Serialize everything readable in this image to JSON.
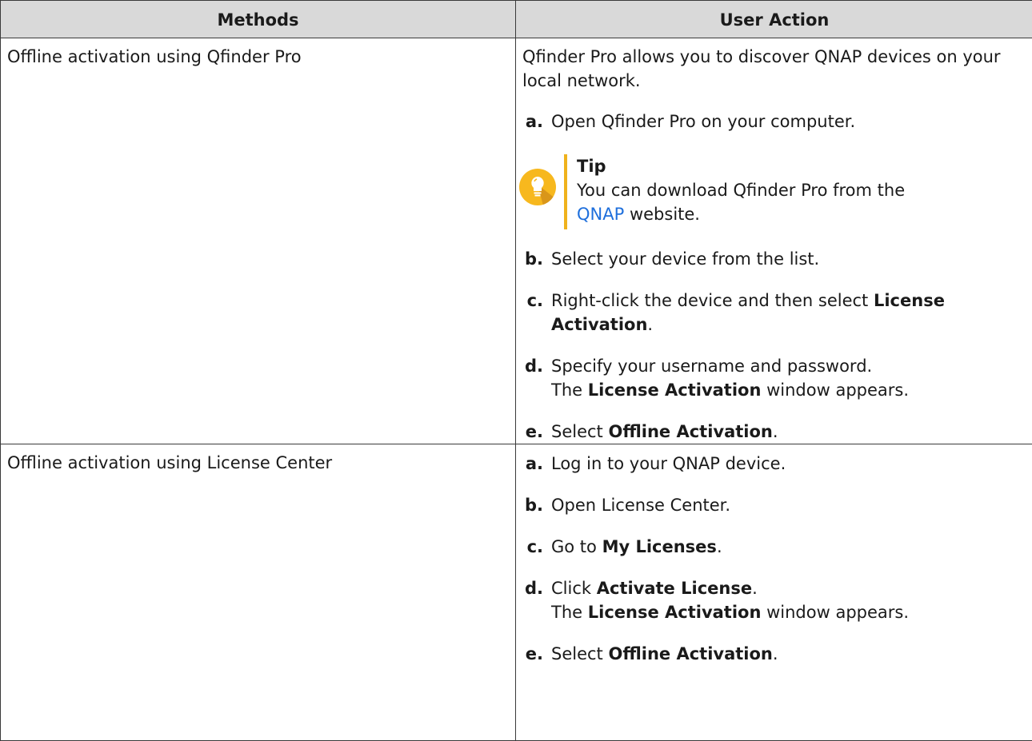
{
  "table": {
    "headers": [
      "Methods",
      "User Action"
    ],
    "rows": [
      {
        "method": "Offline activation using Qfinder Pro",
        "intro": "Qfinder Pro allows you to discover QNAP devices on your local network.",
        "step_a": {
          "letter": "a.",
          "text": "Open Qfinder Pro on your computer."
        },
        "tip": {
          "title": "Tip",
          "text_before": "You can download Qfinder Pro from the ",
          "link": "QNAP",
          "text_after": " website."
        },
        "step_b": {
          "letter": "b.",
          "text": "Select your device from the list."
        },
        "step_c": {
          "letter": "c.",
          "text_before": "Right-click the device and then select ",
          "bold": "License Activation",
          "text_after": "."
        },
        "step_d": {
          "letter": "d.",
          "line1": "Specify your username and password.",
          "line2_before": "The ",
          "line2_bold": "License Activation",
          "line2_after": " window appears."
        },
        "step_e": {
          "letter": "e.",
          "text_before": "Select ",
          "bold": "Offline Activation",
          "text_after": "."
        }
      },
      {
        "method": "Offline activation using License Center",
        "step_a": {
          "letter": "a.",
          "text": "Log in to your QNAP device."
        },
        "step_b": {
          "letter": "b.",
          "text": "Open License Center."
        },
        "step_c": {
          "letter": "c.",
          "text_before": "Go to ",
          "bold": "My Licenses",
          "text_after": "."
        },
        "step_d": {
          "letter": "d.",
          "line1_before": "Click ",
          "line1_bold": "Activate License",
          "line1_after": ".",
          "line2_before": "The ",
          "line2_bold": "License Activation",
          "line2_after": " window appears."
        },
        "step_e": {
          "letter": "e.",
          "text_before": "Select ",
          "bold": "Offline Activation",
          "text_after": "."
        }
      }
    ]
  },
  "icons": {
    "tip": "lightbulb-icon",
    "tip_color": "#f7b81e",
    "link_color": "#1e6fdc",
    "header_bg": "#d9d9d9"
  }
}
